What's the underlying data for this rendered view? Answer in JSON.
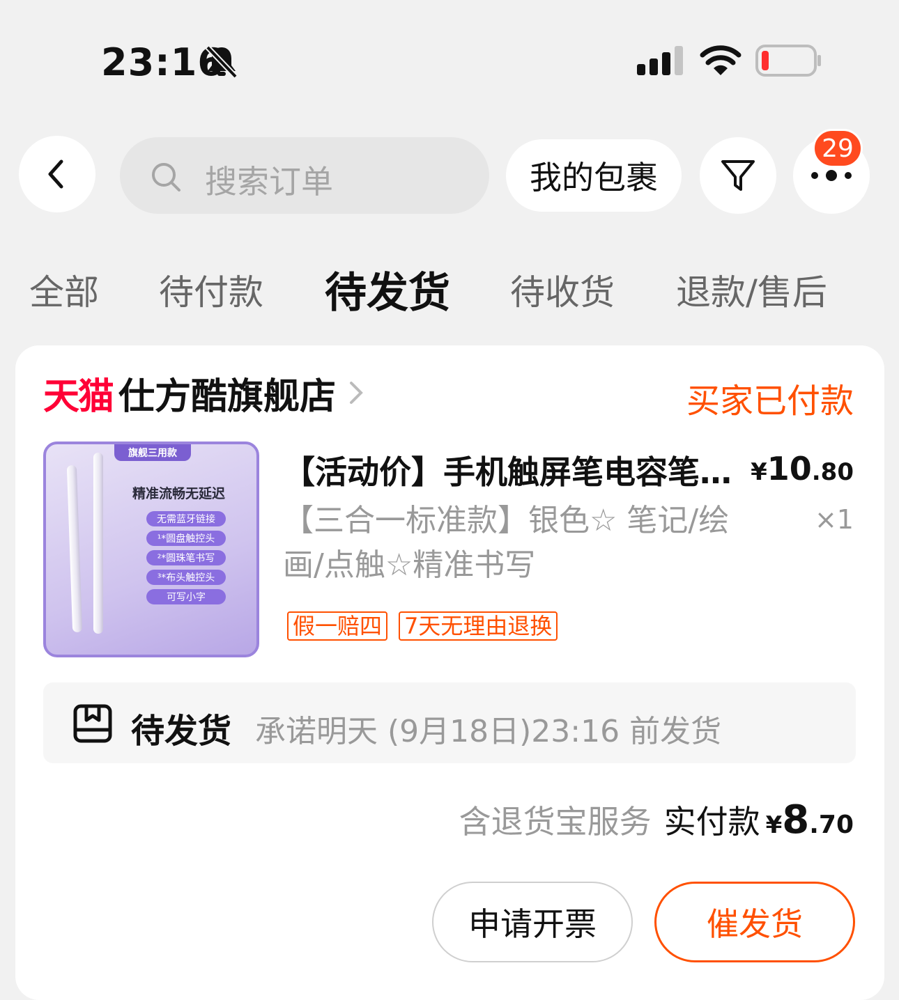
{
  "status_bar": {
    "time": "23:16"
  },
  "header": {
    "search_placeholder": "搜索订单",
    "packages_label": "我的包裹",
    "more_badge": "29"
  },
  "tabs": [
    {
      "label": "全部"
    },
    {
      "label": "待付款"
    },
    {
      "label": "待发货",
      "active": true
    },
    {
      "label": "待收货"
    },
    {
      "label": "退款/售后"
    }
  ],
  "order": {
    "shop_brand": "天猫",
    "shop_name": "仕方酷旗舰店",
    "status": "买家已付款",
    "product": {
      "image_tag": "旗舰三用款",
      "image_title": "精准流畅无延迟",
      "image_features": [
        "无需蓝牙链接",
        "¹*圆盘触控头",
        "²*圆珠笔书写",
        "³*布头触控头",
        "可写小字"
      ],
      "title": "【活动价】手机触屏笔电容笔…",
      "price_symbol": "¥",
      "price_int": "10",
      "price_dec": ".80",
      "sku": "【三合一标准款】银色☆ 笔记/绘画/点触☆精准书写",
      "qty": "×1",
      "tags": [
        "假一赔四",
        "7天无理由退换"
      ]
    },
    "shipping": {
      "title": "待发货",
      "note": "承诺明天 (9月18日)23:16 前发货"
    },
    "payment": {
      "service": "含退货宝服务",
      "label": "实付款",
      "symbol": "¥",
      "int": "8",
      "dec": ".70"
    },
    "buttons": {
      "invoice": "申请开票",
      "urge": "催发货"
    }
  },
  "colors": {
    "accent": "#ff5000",
    "tmall_red": "#ff0036",
    "badge": "#ff4a1f"
  }
}
